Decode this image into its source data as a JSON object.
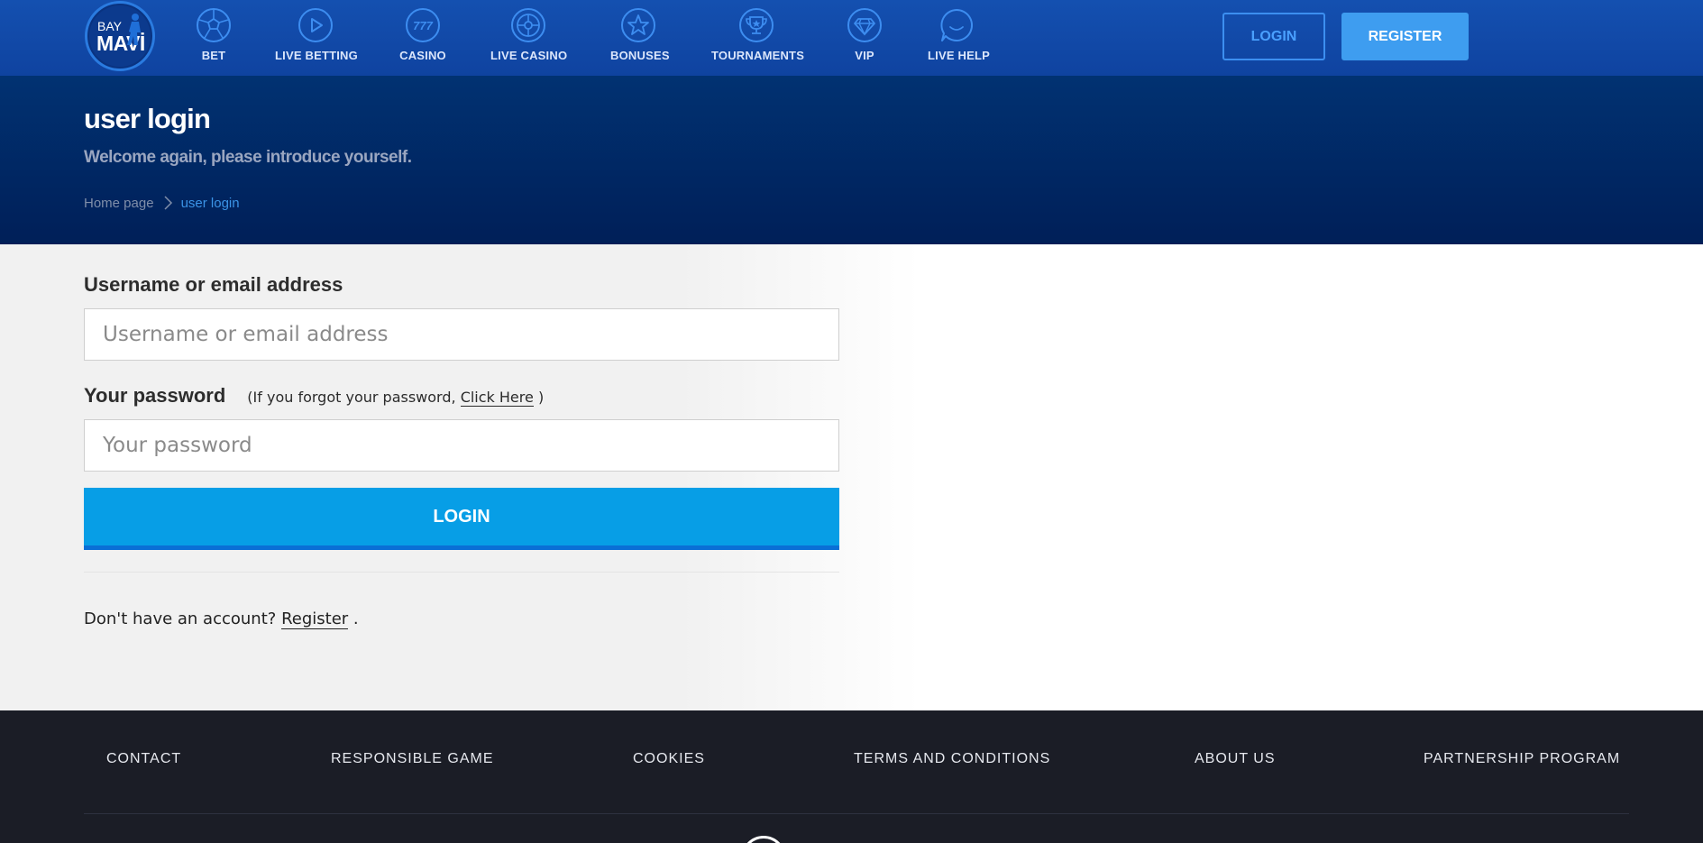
{
  "brand": {
    "line1": "BAY",
    "line2": "MAVİ"
  },
  "nav": {
    "items": [
      {
        "label": "BET",
        "icon": "football-icon"
      },
      {
        "label": "LIVE BETTING",
        "icon": "play-icon"
      },
      {
        "label": "CASINO",
        "icon": "slot-777-icon"
      },
      {
        "label": "LIVE CASINO",
        "icon": "roulette-icon"
      },
      {
        "label": "BONUSES",
        "icon": "star-icon"
      },
      {
        "label": "TOURNAMENTS",
        "icon": "trophy-icon"
      },
      {
        "label": "VIP",
        "icon": "diamond-icon"
      },
      {
        "label": "LIVE HELP",
        "icon": "chat-bubble-icon"
      }
    ],
    "login_label": "LOGIN",
    "register_label": "REGISTER"
  },
  "hero": {
    "title": "user login",
    "subtitle": "Welcome again, please introduce yourself.",
    "breadcrumb": {
      "home": "Home page",
      "current": "user login"
    }
  },
  "form": {
    "username_label": "Username or email address",
    "username_placeholder": "Username or email address",
    "password_label": "Your password",
    "forgot_prefix": "(If you forgot your password,",
    "forgot_link": "Click Here",
    "forgot_suffix": ")",
    "submit_label": "LOGIN",
    "no_account_text": "Don't have an account?",
    "register_link": "Register",
    "no_account_suffix": "."
  },
  "footer": {
    "links": [
      "CONTACT",
      "RESPONSIBLE GAME",
      "COOKIES",
      "TERMS AND CONDITIONS",
      "ABOUT US",
      "PARTNERSHIP PROGRAM"
    ]
  },
  "colors": {
    "nav_bg": "#1450b0",
    "hero_bg": "#002560",
    "accent": "#079ee6",
    "register_btn": "#3e9df0",
    "footer_bg": "#1b1d26"
  }
}
